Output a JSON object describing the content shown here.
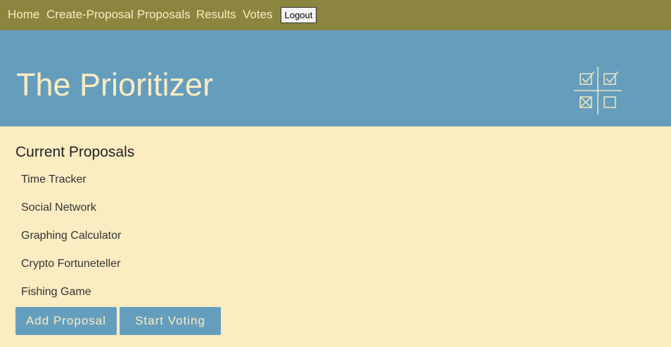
{
  "nav": {
    "links": [
      "Home",
      "Create-Proposal",
      "Proposals",
      "Results",
      "Votes"
    ],
    "logout_label": "Logout"
  },
  "banner": {
    "title": "The Prioritizer",
    "logo_icon": "checkbox-grid-icon"
  },
  "main": {
    "section_title": "Current Proposals",
    "proposals": [
      "Time Tracker",
      "Social Network",
      "Graphing Calculator",
      "Crypto Fortuneteller",
      "Fishing Game"
    ],
    "add_proposal_label": "Add Proposal",
    "start_voting_label": "Start Voting"
  },
  "colors": {
    "nav_bg": "#8c853f",
    "banner_bg": "#659ebd",
    "page_bg": "#fbecc2",
    "accent_text": "#fbecc2"
  }
}
